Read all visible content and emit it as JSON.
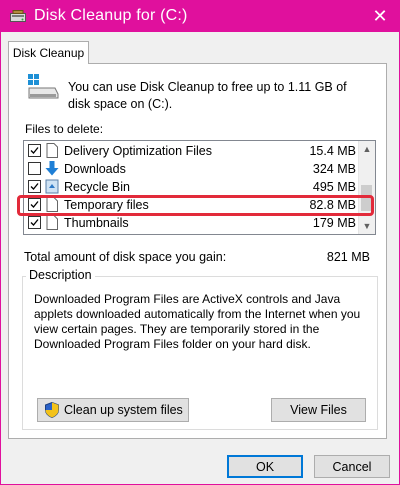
{
  "window": {
    "title": "Disk Cleanup for  (C:)",
    "close_glyph": "✕",
    "title_color": "#e0109d"
  },
  "tab": {
    "label": "Disk Cleanup"
  },
  "intro": {
    "text": "You can use Disk Cleanup to free up to 1.11 GB of disk space on  (C:)."
  },
  "files": {
    "label": "Files to delete:",
    "items": [
      {
        "name": "Delivery Optimization Files",
        "size": "15.4 MB",
        "checked": true,
        "icon": "file-icon"
      },
      {
        "name": "Downloads",
        "size": "324 MB",
        "checked": false,
        "icon": "download-arrow-icon"
      },
      {
        "name": "Recycle Bin",
        "size": "495 MB",
        "checked": true,
        "icon": "recycle-bin-icon"
      },
      {
        "name": "Temporary files",
        "size": "82.8 MB",
        "checked": true,
        "icon": "file-icon"
      },
      {
        "name": "Thumbnails",
        "size": "179 MB",
        "checked": true,
        "icon": "file-icon"
      }
    ]
  },
  "total": {
    "label": "Total amount of disk space you gain:",
    "value": "821 MB"
  },
  "description": {
    "label": "Description",
    "text": "Downloaded Program Files are ActiveX controls and Java applets downloaded automatically from the Internet when you view certain pages. They are temporarily stored in the Downloaded Program Files folder on your hard disk."
  },
  "buttons": {
    "cleanup_system": "Clean up system files",
    "view_files": "View Files",
    "ok": "OK",
    "cancel": "Cancel"
  },
  "highlight_color": "#e22a3a"
}
